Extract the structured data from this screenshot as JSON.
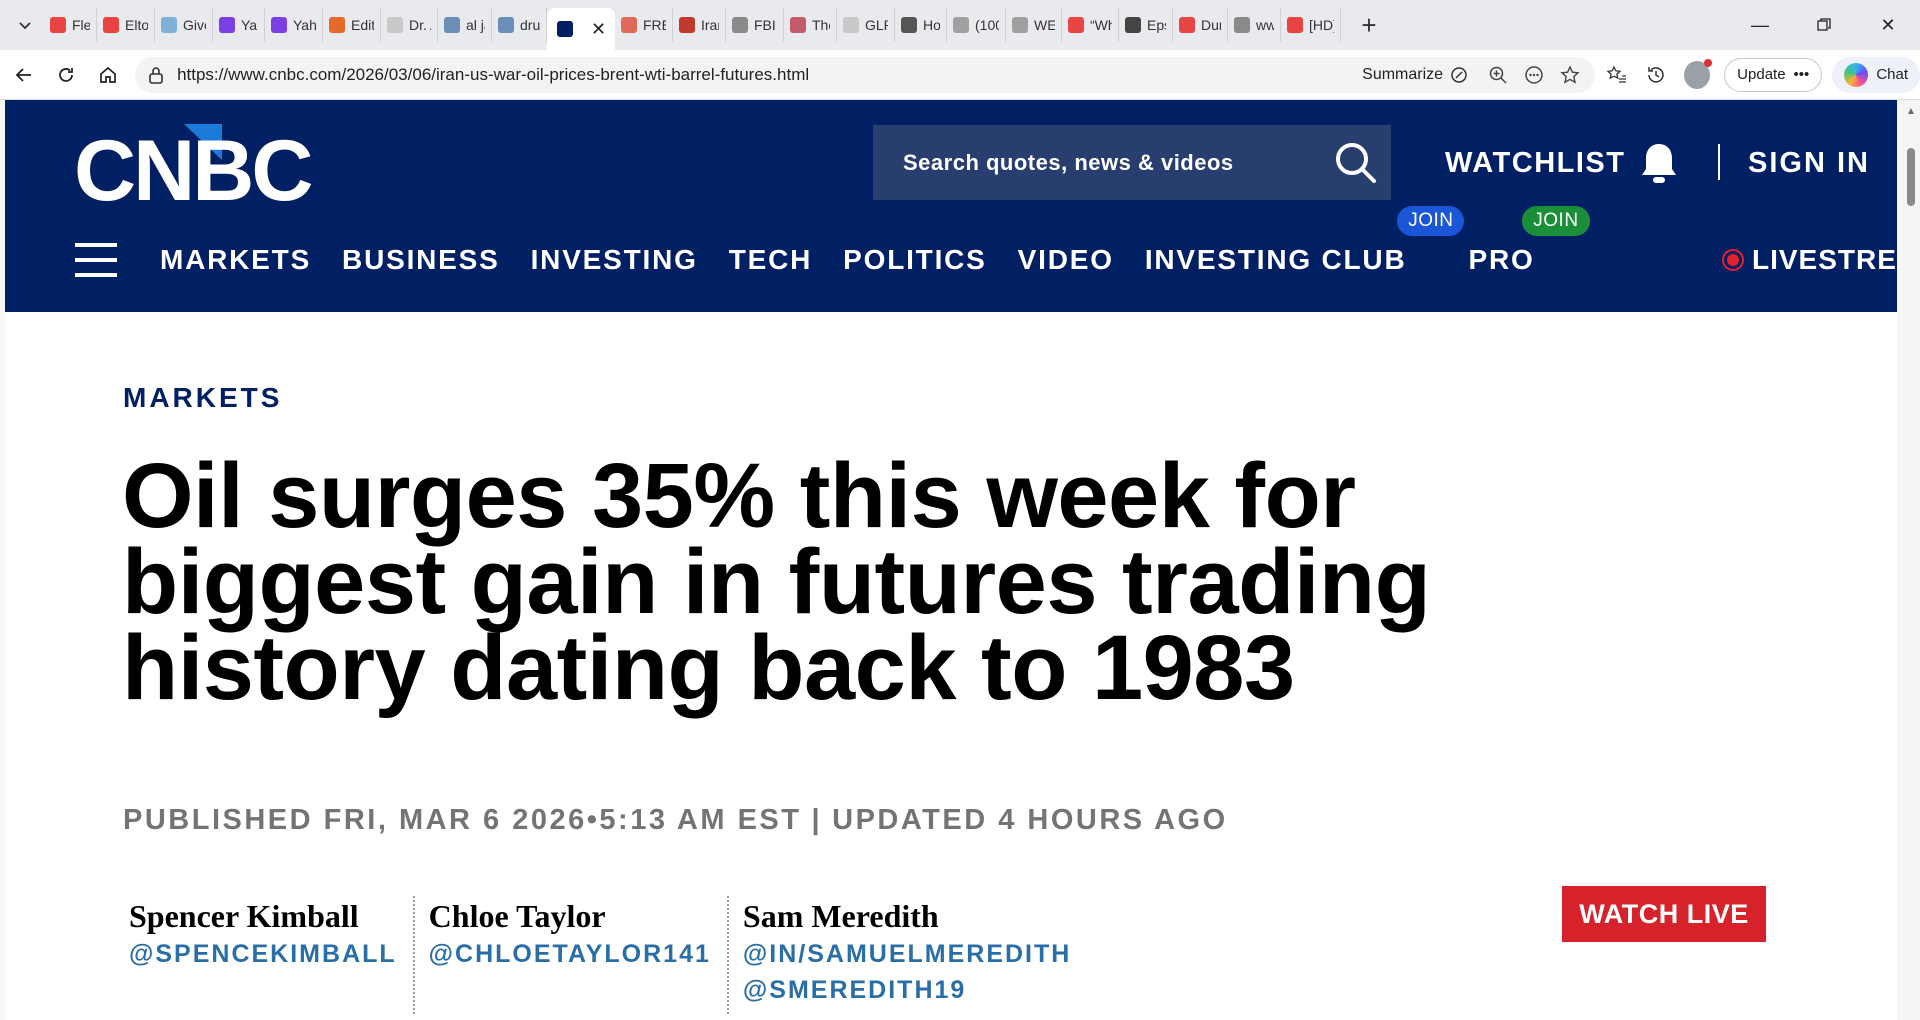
{
  "browser": {
    "tabs": [
      {
        "label": "Flee",
        "color": "#e94444"
      },
      {
        "label": "Elto",
        "color": "#e94444"
      },
      {
        "label": "Give",
        "color": "#7fb0d8"
      },
      {
        "label": "Yahc",
        "color": "#7b3fe4"
      },
      {
        "label": "Yahc",
        "color": "#7b3fe4"
      },
      {
        "label": "Editi",
        "color": "#e6682a"
      },
      {
        "label": "Dr. A",
        "color": "#c9c9c9"
      },
      {
        "label": "al ja",
        "color": "#6b8fb8"
      },
      {
        "label": "druc",
        "color": "#6b8fb8"
      },
      {
        "label": "",
        "color": "#002063",
        "active": true
      },
      {
        "label": "FRES",
        "color": "#e06a5a"
      },
      {
        "label": "Iran",
        "color": "#c0392b"
      },
      {
        "label": "FBI L",
        "color": "#8a8a8a"
      },
      {
        "label": "The",
        "color": "#c45b6a"
      },
      {
        "label": "GLP",
        "color": "#c8c8c8"
      },
      {
        "label": "How",
        "color": "#555555"
      },
      {
        "label": "(100",
        "color": "#a0a0a0"
      },
      {
        "label": "WEF",
        "color": "#a0a0a0"
      },
      {
        "label": "“Wh",
        "color": "#e94444"
      },
      {
        "label": "Epst",
        "color": "#444444"
      },
      {
        "label": "Dura",
        "color": "#e94444"
      },
      {
        "label": "www",
        "color": "#8a8a8a"
      },
      {
        "label": "[HD]",
        "color": "#e94444"
      }
    ],
    "url": "https://www.cnbc.com/2026/03/06/iran-us-war-oil-prices-brent-wti-barrel-futures.html",
    "summarize_label": "Summarize",
    "update_label": "Update",
    "chat_label": "Chat"
  },
  "site": {
    "logo_text": "CNBC",
    "search_placeholder": "Search quotes, news & videos",
    "watchlist_label": "WATCHLIST",
    "signin_label": "SIGN IN",
    "nav": [
      {
        "label": "MARKETS"
      },
      {
        "label": "BUSINESS"
      },
      {
        "label": "INVESTING"
      },
      {
        "label": "TECH"
      },
      {
        "label": "POLITICS"
      },
      {
        "label": "VIDEO"
      },
      {
        "label": "INVESTING CLUB",
        "badge": "JOIN",
        "badge_color": "#1a56d6"
      },
      {
        "label": "PRO",
        "badge": "JOIN",
        "badge_color": "#1b8e3a"
      }
    ],
    "livestream_label": "LIVESTREA"
  },
  "article": {
    "kicker": "MARKETS",
    "headline": "Oil surges 35% this week for biggest gain in futures trading history dating back to 1983",
    "published": "PUBLISHED FRI, MAR 6 2026•5:13 AM EST",
    "updated": "UPDATED 4 HOURS AGO",
    "authors": [
      {
        "name": "Spencer Kimball",
        "handles": [
          "@SPENCEKIMBALL"
        ]
      },
      {
        "name": "Chloe Taylor",
        "handles": [
          "@CHLOETAYLOR141"
        ]
      },
      {
        "name": "Sam Meredith",
        "handles": [
          "@IN/SAMUELMEREDITH",
          "@SMEREDITH19"
        ]
      }
    ],
    "watch_live_label": "WATCH LIVE"
  }
}
